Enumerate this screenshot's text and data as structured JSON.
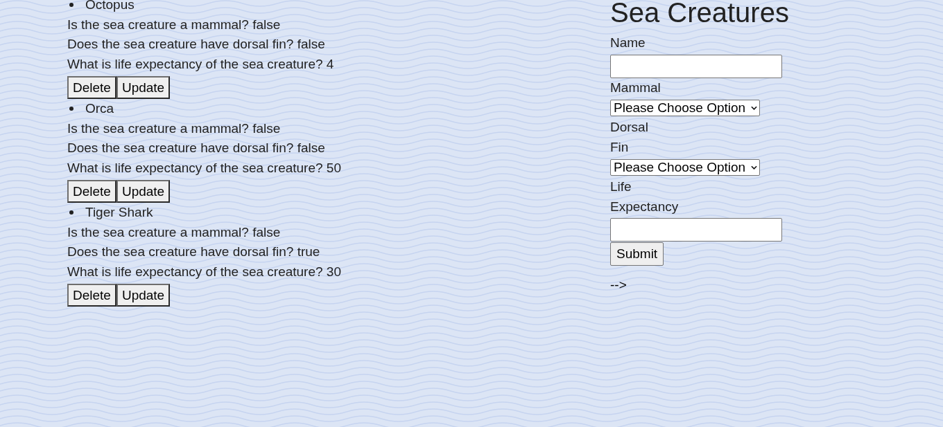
{
  "creatures": [
    {
      "name": "Octopus",
      "mammal_line": "Is the sea creature a mammal? false",
      "dorsal_line": "Does the sea creature have dorsal fin? false",
      "life_line": "What is life expectancy of the sea creature? 4",
      "buttons": [
        "Delete",
        "Update"
      ]
    },
    {
      "name": "Orca",
      "mammal_line": "Is the sea creature a mammal? false",
      "dorsal_line": "Does the sea creature have dorsal fin? false",
      "life_line": "What is life expectancy of the sea creature? 50",
      "buttons": [
        "Delete",
        "Update"
      ]
    },
    {
      "name": "Tiger Shark",
      "mammal_line": "Is the sea creature a mammal? false",
      "dorsal_line": "Does the sea creature have dorsal fin? true",
      "life_line": "What is life expectancy of the sea creature? 30",
      "buttons": [
        "Delete",
        "Update"
      ]
    }
  ],
  "form": {
    "title": "Sea Creatures",
    "fields": [
      {
        "kind": "text",
        "label": "Name"
      },
      {
        "kind": "select",
        "label": "Mammal",
        "value": "Please Choose Option"
      },
      {
        "kind": "select",
        "label": "Dorsal Fin",
        "value": "Please Choose Option"
      },
      {
        "kind": "text",
        "label": "Life Expectancy"
      }
    ],
    "submit": "Submit"
  },
  "trailing_text": "-->"
}
